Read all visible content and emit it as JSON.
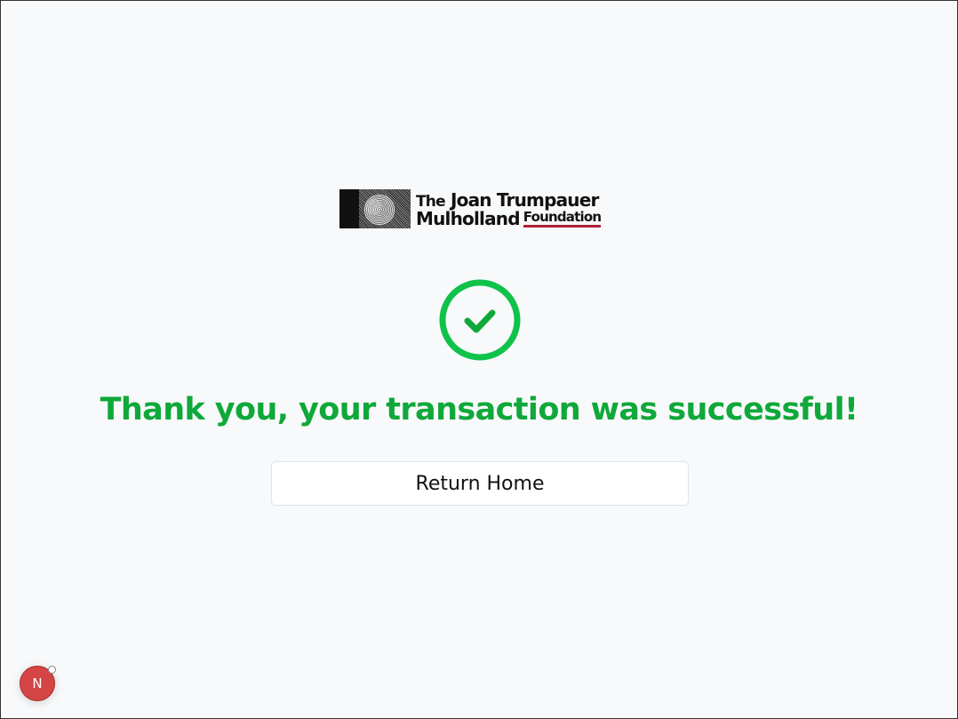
{
  "logo": {
    "line1_the": "The",
    "line1_rest": " Joan Trumpauer",
    "line2_main": "Mulholland",
    "line2_foundation": "Foundation",
    "accent_color": "#b0213a"
  },
  "status": {
    "icon": "check-circle-icon",
    "color": "#0fa83a",
    "message": "Thank you, your transaction was successful!"
  },
  "actions": {
    "return_label": "Return Home"
  },
  "dev_badge": {
    "icon": "nextjs-icon",
    "label": "N",
    "color": "#d64545"
  }
}
